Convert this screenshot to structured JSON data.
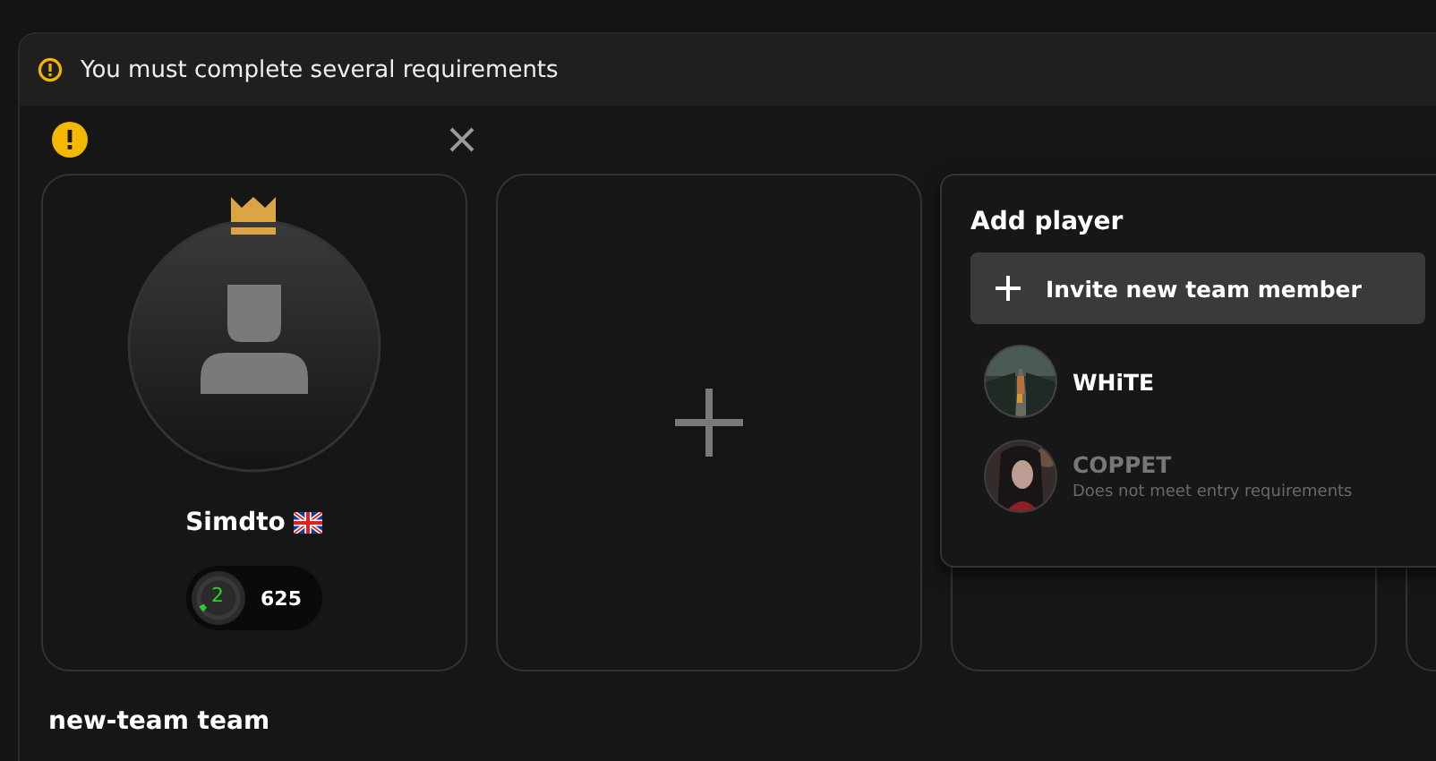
{
  "banner": {
    "text": "You must complete several requirements"
  },
  "slots": [
    {
      "kind": "player",
      "name": "Simdto",
      "captain": true,
      "level_badge": "2",
      "rating": "625"
    },
    {
      "kind": "add"
    },
    {
      "kind": "empty"
    },
    {
      "kind": "empty"
    }
  ],
  "add_player": {
    "title": "Add player",
    "invite_label": "Invite new team member",
    "players": [
      {
        "name": "WHiTE",
        "eligible": true
      },
      {
        "name": "COPPET",
        "eligible": false,
        "note": "Does not meet entry requirements"
      }
    ]
  },
  "team_name": "new-team team"
}
